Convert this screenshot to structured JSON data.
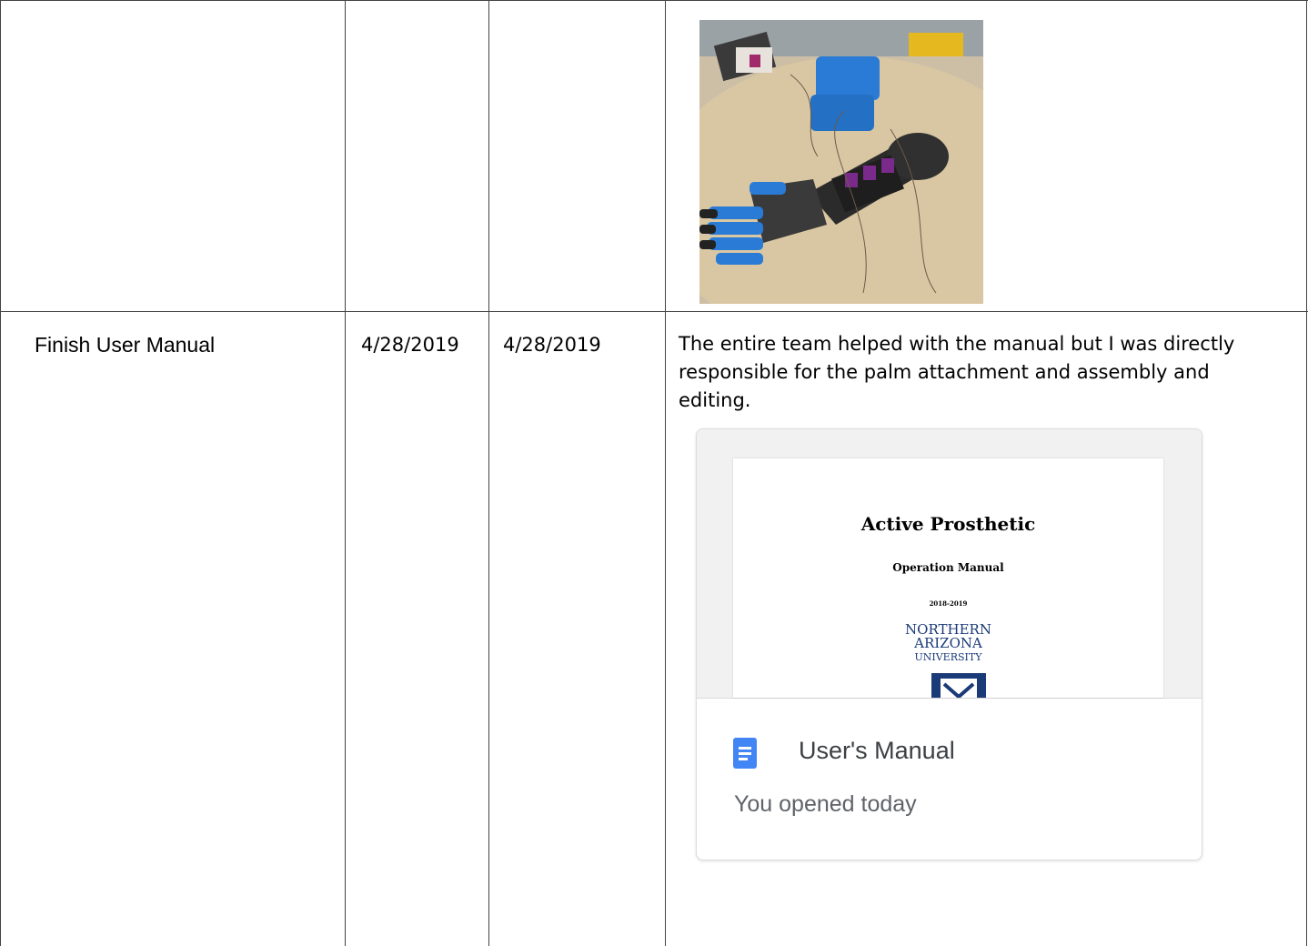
{
  "rows": [
    {
      "task": "",
      "start_date": "",
      "end_date": "",
      "description": "",
      "image": "prosthetic-arm-photo"
    },
    {
      "task": "Finish User Manual",
      "start_date": "4/28/2019",
      "end_date": "4/28/2019",
      "description": "The entire team helped with the manual but I was directly responsible for the palm attachment and assembly and editing."
    }
  ],
  "drive_card": {
    "file_name": "User's Manual",
    "activity": "You opened today",
    "icon": "google-docs-icon",
    "icon_color": "#4285f4",
    "preview": {
      "title": "Active Prosthetic",
      "subtitle": "Operation Manual",
      "year": "2018-2019",
      "logo_line1": "NORTHERN",
      "logo_line2": "ARIZONA",
      "logo_line3": "UNIVERSITY"
    }
  },
  "colors": {
    "grid": "#444444",
    "university_blue": "#1a3a78"
  }
}
